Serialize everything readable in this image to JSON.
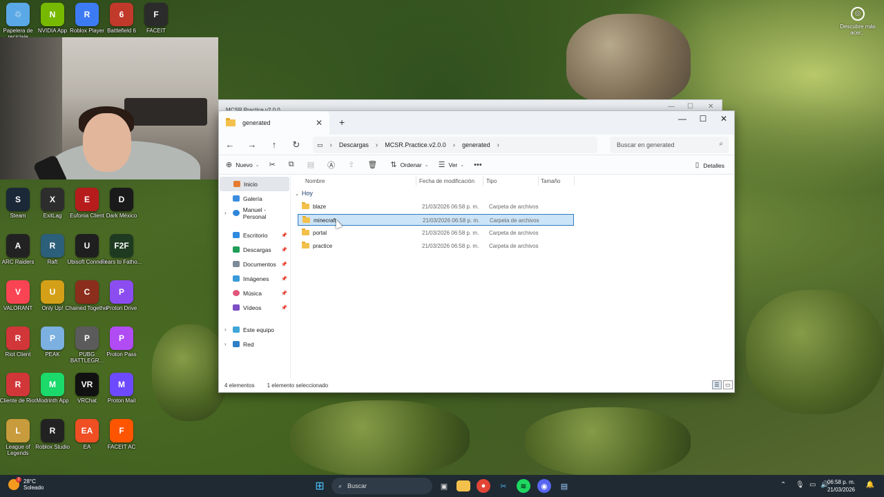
{
  "desktop": {
    "icons": [
      {
        "label": "Papelera de reciclaje",
        "color": "#5aa9e6",
        "glyph": "♲"
      },
      {
        "label": "NVIDIA App",
        "color": "#76b900",
        "glyph": "N"
      },
      {
        "label": "Roblox Player",
        "color": "#3d7bf5",
        "glyph": "R"
      },
      {
        "label": "Battlefield 6",
        "color": "#c0392b",
        "glyph": "6"
      },
      {
        "label": "FACEIT",
        "color": "#2b2b2b",
        "glyph": "F"
      },
      {
        "label": "Steam",
        "color": "#1b2838",
        "glyph": "S"
      },
      {
        "label": "ExitLag",
        "color": "#2d2d2d",
        "glyph": "X"
      },
      {
        "label": "Eufonia Client",
        "color": "#b71c1c",
        "glyph": "E"
      },
      {
        "label": "Dark México",
        "color": "#1a1a1a",
        "glyph": "D"
      },
      {
        "label": "ARC Raiders",
        "color": "#222222",
        "glyph": "A"
      },
      {
        "label": "Raft",
        "color": "#2c5f7a",
        "glyph": "R"
      },
      {
        "label": "Ubisoft Connect",
        "color": "#1f1f1f",
        "glyph": "U"
      },
      {
        "label": "Fears to Fatho...",
        "color": "#1e3b22",
        "glyph": "F2F"
      },
      {
        "label": "VALORANT",
        "color": "#fa4454",
        "glyph": "V"
      },
      {
        "label": "Only Up!",
        "color": "#d4a017",
        "glyph": "U"
      },
      {
        "label": "Chained Together",
        "color": "#8b2e1c",
        "glyph": "C"
      },
      {
        "label": "Proton Drive",
        "color": "#8c4df0",
        "glyph": "P"
      },
      {
        "label": "Riot Client",
        "color": "#d13639",
        "glyph": "R"
      },
      {
        "label": "PEAK",
        "color": "#7bb0e0",
        "glyph": "P"
      },
      {
        "label": "PUBG BATTLEGR...",
        "color": "#5b5b5b",
        "glyph": "P"
      },
      {
        "label": "Proton Pass",
        "color": "#b14bf4",
        "glyph": "P"
      },
      {
        "label": "Cliente de Riot",
        "color": "#d13639",
        "glyph": "R"
      },
      {
        "label": "Modrinth App",
        "color": "#1bd96a",
        "glyph": "M"
      },
      {
        "label": "VRChat",
        "color": "#111111",
        "glyph": "VR"
      },
      {
        "label": "Proton Mail",
        "color": "#6d4aff",
        "glyph": "M"
      },
      {
        "label": "League of Legends",
        "color": "#c89b3c",
        "glyph": "L"
      },
      {
        "label": "Roblox Studio",
        "color": "#222222",
        "glyph": "R"
      },
      {
        "label": "EA",
        "color": "#f04e23",
        "glyph": "EA"
      },
      {
        "label": "FACEIT AC",
        "color": "#ff5500",
        "glyph": "F"
      }
    ],
    "discover": "Descubre más acer..."
  },
  "back_window": {
    "title": "MCSR.Practice.v2.0.0"
  },
  "explorer": {
    "tab_title": "generated",
    "breadcrumb": [
      "Descargas",
      "MCSR.Practice.v2.0.0",
      "generated"
    ],
    "search_placeholder": "Buscar en generated",
    "commands": {
      "nuevo": "Nuevo",
      "ordenar": "Ordenar",
      "ver": "Ver",
      "detalles": "Detalles"
    },
    "nav": {
      "inicio": "Inicio",
      "galeria": "Galería",
      "personal": "Manuel - Personal",
      "escritorio": "Escritorio",
      "descargas": "Descargas",
      "documentos": "Documentos",
      "imagenes": "Imágenes",
      "musica": "Música",
      "videos": "Vídeos",
      "este_equipo": "Este equipo",
      "red": "Red"
    },
    "columns": {
      "name": "Nombre",
      "date": "Fecha de modificación",
      "type": "Tipo",
      "size": "Tamaño"
    },
    "group": "Hoy",
    "rows": [
      {
        "name": "blaze",
        "date": "21/03/2026 06:58 p. m.",
        "type": "Carpeta de archivos"
      },
      {
        "name": "minecraft",
        "date": "21/03/2026 06:58 p. m.",
        "type": "Carpeta de archivos"
      },
      {
        "name": "portal",
        "date": "21/03/2026 06:58 p. m.",
        "type": "Carpeta de archivos"
      },
      {
        "name": "practice",
        "date": "21/03/2026 06:58 p. m.",
        "type": "Carpeta de archivos"
      }
    ],
    "status": {
      "count": "4 elementos",
      "selected": "1 elemento seleccionado"
    }
  },
  "taskbar": {
    "weather_temp": "28°C",
    "weather_desc": "Soleado",
    "search": "Buscar",
    "time": "06:58 p. m.",
    "date": "21/03/2026"
  }
}
